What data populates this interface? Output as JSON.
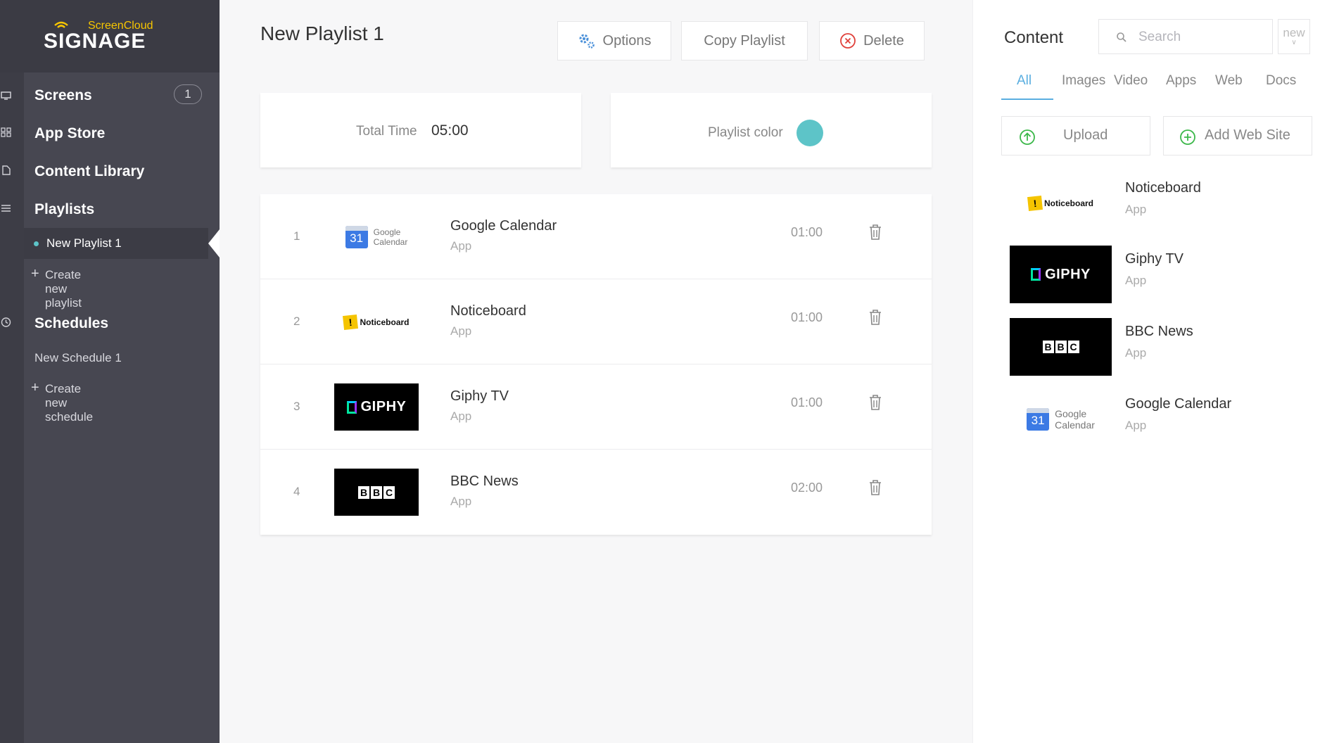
{
  "brand": {
    "small": "ScreenCloud",
    "title": "SIGNAGE"
  },
  "sidebar": {
    "screens": {
      "label": "Screens",
      "badge": "1"
    },
    "app_store": "App Store",
    "content_library": "Content Library",
    "playlists": "Playlists",
    "active_playlist": "New Playlist 1",
    "create_playlist": "Create new playlist",
    "schedules": "Schedules",
    "schedule_item": "New Schedule 1",
    "create_schedule": "Create new schedule",
    "plus": "+"
  },
  "main": {
    "title": "New Playlist 1",
    "buttons": {
      "options": "Options",
      "copy": "Copy Playlist",
      "delete": "Delete"
    },
    "total_time_label": "Total Time",
    "total_time_value": "05:00",
    "playlist_color_label": "Playlist color",
    "playlist_color": "#5dc4c8",
    "items": [
      {
        "index": "1",
        "name": "Google Calendar",
        "type": "App",
        "duration": "01:00",
        "thumb": "google-calendar"
      },
      {
        "index": "2",
        "name": "Noticeboard",
        "type": "App",
        "duration": "01:00",
        "thumb": "noticeboard"
      },
      {
        "index": "3",
        "name": "Giphy TV",
        "type": "App",
        "duration": "01:00",
        "thumb": "giphy"
      },
      {
        "index": "4",
        "name": "BBC News",
        "type": "App",
        "duration": "02:00",
        "thumb": "bbc"
      }
    ]
  },
  "content": {
    "title": "Content",
    "search_placeholder": "Search",
    "new_label": "new",
    "tabs": [
      "All",
      "Images",
      "Video",
      "Apps",
      "Web",
      "Docs"
    ],
    "upload": "Upload",
    "add_web_site": "Add Web Site",
    "items": [
      {
        "name": "Noticeboard",
        "type": "App",
        "thumb": "noticeboard"
      },
      {
        "name": "Giphy TV",
        "type": "App",
        "thumb": "giphy"
      },
      {
        "name": "BBC News",
        "type": "App",
        "thumb": "bbc"
      },
      {
        "name": "Google Calendar",
        "type": "App",
        "thumb": "google-calendar"
      }
    ]
  },
  "logos": {
    "gcal_day": "31",
    "gcal_line1": "Google",
    "gcal_line2": "Calendar",
    "notice_mark": "!",
    "notice_text": "Noticeboard",
    "giphy_text": "GIPHY",
    "bbc_letters": [
      "B",
      "B",
      "C"
    ]
  },
  "colors": {
    "accent": "#5aaee0",
    "sidebar": "#474751",
    "success": "#3cb84a",
    "danger": "#e0403a"
  }
}
